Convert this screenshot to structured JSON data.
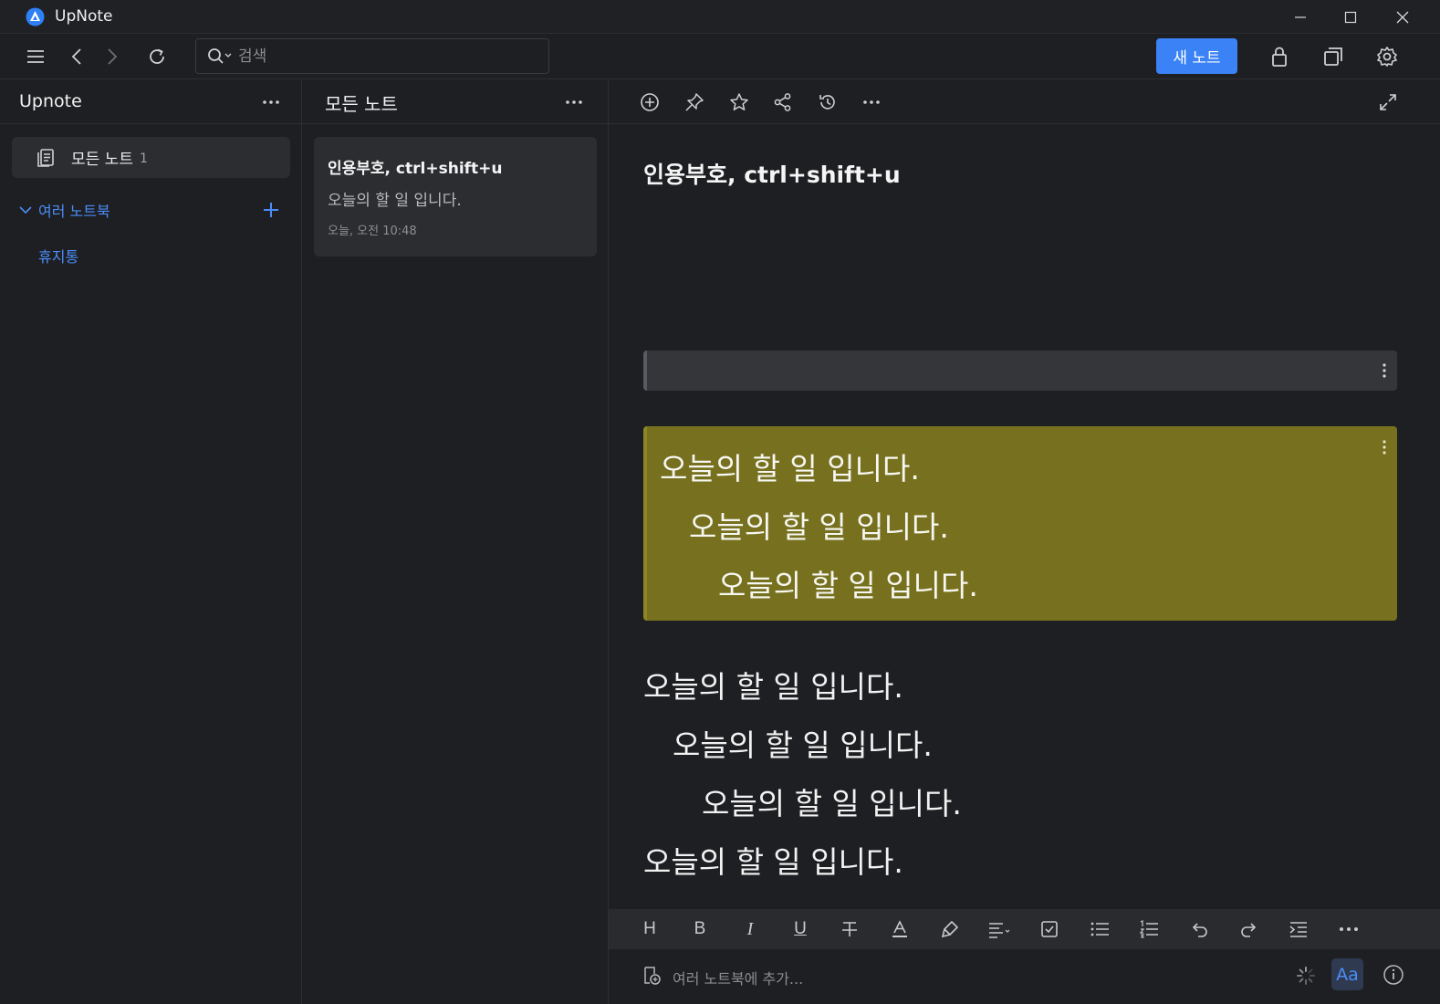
{
  "window": {
    "app_title": "UpNote",
    "logo_icon": "upnote-logo-icon",
    "accent_color": "#3b82f6"
  },
  "toolbar": {
    "search": {
      "placeholder": "검색",
      "value": ""
    },
    "new_note_label": "새 노트",
    "icons": [
      "menu-icon",
      "back-icon",
      "forward-icon",
      "refresh-icon",
      "lock-icon",
      "copy-window-icon",
      "gear-icon"
    ]
  },
  "sidebar": {
    "title": "Upnote",
    "all_notes": {
      "label": "모든 노트",
      "count": "1"
    },
    "notebooks_label": "여러 노트북",
    "trash_label": "휴지통"
  },
  "note_list": {
    "title": "모든 노트",
    "notes": [
      {
        "title": "인용부호, ctrl+shift+u",
        "preview": "오늘의 할 일 입니다.",
        "date": "오늘, 오전 10:48"
      }
    ]
  },
  "editor": {
    "title": "인용부호, ctrl+shift+u",
    "highlight_color": "#77711f",
    "quote_lines": [
      "오늘의 할 일 입니다.",
      "오늘의 할 일 입니다.",
      "오늘의 할 일 입니다."
    ],
    "body_lines": [
      "오늘의 할 일 입니다.",
      "오늘의 할 일 입니다.",
      "오늘의 할 일 입니다.",
      "오늘의 할 일 입니다."
    ],
    "format_bar": {
      "heading_label": "H",
      "bold_label": "B",
      "italic_label": "I",
      "underline_label": "U"
    },
    "footer": {
      "add_to_notebook_label": "여러 노트북에 추가...",
      "font_button_label": "Aa"
    }
  }
}
